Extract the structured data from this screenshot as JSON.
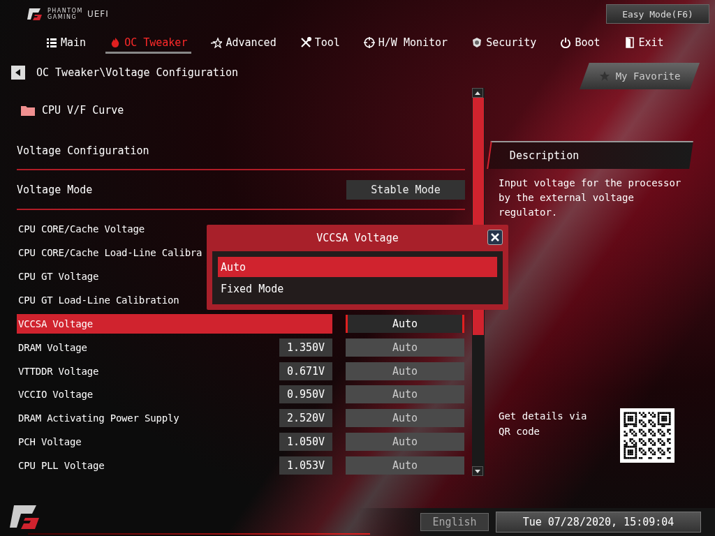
{
  "header": {
    "brand_line_1": "PHANTOM",
    "brand_line_2": "GAMING",
    "product": "UEFI",
    "mode_button": "Easy Mode(F6)"
  },
  "tabs": [
    {
      "label": "Main",
      "selected": false
    },
    {
      "label": "OC Tweaker",
      "selected": true
    },
    {
      "label": "Advanced",
      "selected": false
    },
    {
      "label": "Tool",
      "selected": false
    },
    {
      "label": "H/W Monitor",
      "selected": false
    },
    {
      "label": "Security",
      "selected": false
    },
    {
      "label": "Boot",
      "selected": false
    },
    {
      "label": "Exit",
      "selected": false
    }
  ],
  "breadcrumb": "OC Tweaker\\Voltage Configuration",
  "favorite_button": "My Favorite",
  "items": [
    {
      "kind": "folder",
      "label": "CPU V/F Curve"
    },
    {
      "kind": "section",
      "label": "Voltage Configuration"
    },
    {
      "kind": "mode",
      "label": "Voltage Mode",
      "setting": "Stable Mode"
    },
    {
      "kind": "option",
      "label": "CPU CORE/Cache Voltage",
      "selected": false
    },
    {
      "kind": "option",
      "label": "CPU CORE/Cache Load-Line Calibra",
      "selected": false
    },
    {
      "kind": "option",
      "label": "CPU GT Voltage",
      "selected": false
    },
    {
      "kind": "option",
      "label": "CPU GT Load-Line Calibration",
      "selected": false
    },
    {
      "kind": "option",
      "label": "VCCSA Voltage",
      "setting": "Auto",
      "selected": true
    },
    {
      "kind": "option",
      "label": "DRAM Voltage",
      "value": "1.350V",
      "setting": "Auto",
      "selected": false
    },
    {
      "kind": "option",
      "label": "VTTDDR Voltage",
      "value": "0.671V",
      "setting": "Auto",
      "selected": false
    },
    {
      "kind": "option",
      "label": "VCCIO Voltage",
      "value": "0.950V",
      "setting": "Auto",
      "selected": false
    },
    {
      "kind": "option",
      "label": "DRAM Activating Power Supply",
      "value": "2.520V",
      "setting": "Auto",
      "selected": false
    },
    {
      "kind": "option",
      "label": "PCH Voltage",
      "value": "1.050V",
      "setting": "Auto",
      "selected": false
    },
    {
      "kind": "option",
      "label": "CPU PLL Voltage",
      "value": "1.053V",
      "setting": "Auto",
      "selected": false
    }
  ],
  "dialog": {
    "title": "VCCSA Voltage",
    "options": [
      {
        "label": "Auto",
        "selected": true
      },
      {
        "label": "Fixed Mode",
        "selected": false
      }
    ]
  },
  "description": {
    "title": "Description",
    "text": "Input voltage for the processor by the external voltage regulator."
  },
  "qr_text": "Get details via QR code",
  "footer": {
    "language": "English",
    "datetime": "Tue 07/28/2020, 15:09:04"
  }
}
